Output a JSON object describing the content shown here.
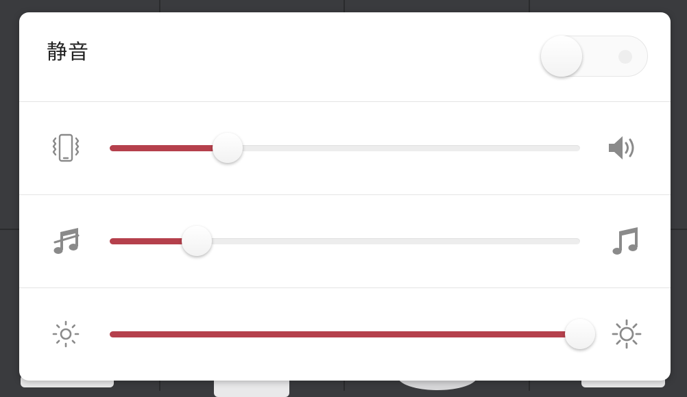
{
  "panel": {
    "mute": {
      "label": "静音",
      "enabled": false
    },
    "sliders": [
      {
        "name": "ringer-volume",
        "left_icon": "vibrate-phone-icon",
        "right_icon": "speaker-volume-icon",
        "level": 0.25
      },
      {
        "name": "media-volume",
        "left_icon": "music-note-muted-icon",
        "right_icon": "music-note-icon",
        "level": 0.185
      },
      {
        "name": "brightness",
        "left_icon": "brightness-low-icon",
        "right_icon": "brightness-high-icon",
        "level": 1.0
      }
    ]
  },
  "colors": {
    "accent": "#b5404c",
    "track": "#ededed",
    "icon": "#8a8a8a"
  }
}
